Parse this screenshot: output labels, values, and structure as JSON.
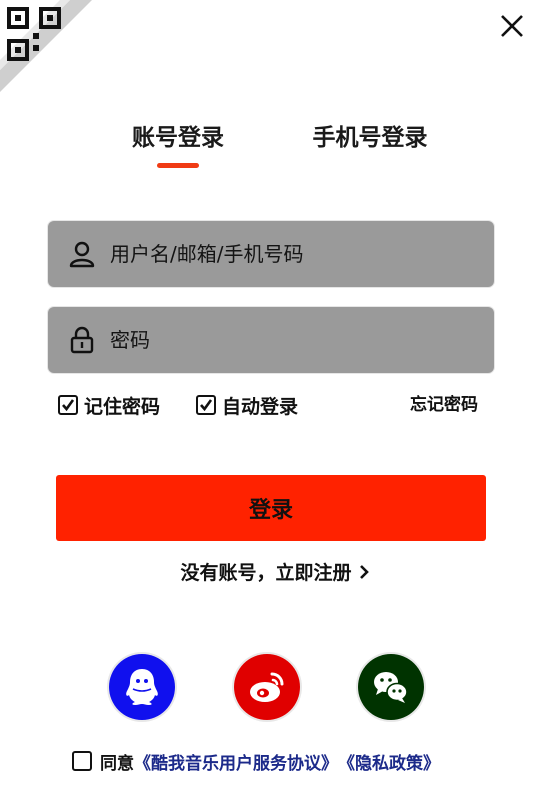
{
  "icons": {
    "qr": "qr-code-icon",
    "close": "close-icon",
    "user": "user-icon",
    "lock": "lock-icon",
    "check": "check-icon",
    "chevron": "chevron-right-icon",
    "qq": "qq-icon",
    "weibo": "weibo-icon",
    "wechat": "wechat-icon"
  },
  "tabs": {
    "account": "账号登录",
    "phone": "手机号登录",
    "active": "account"
  },
  "form": {
    "username_placeholder": "用户名/邮箱/手机号码",
    "password_placeholder": "密码",
    "remember_label": "记住密码",
    "remember_checked": true,
    "autologin_label": "自动登录",
    "autologin_checked": true,
    "forgot_label": "忘记密码",
    "login_label": "登录",
    "register_label": "没有账号，立即注册"
  },
  "agreement": {
    "prefix": "同意",
    "terms": "《酷我音乐用户服务协议》",
    "privacy": "《隐私政策》",
    "checked": false
  },
  "colors": {
    "accent": "#ff2200",
    "tab_underline": "#f03b14",
    "field_bg": "#9a9a9a",
    "qq": "#1010ee",
    "weibo": "#e00000",
    "wechat": "#003300",
    "link": "#1c2a8a"
  }
}
